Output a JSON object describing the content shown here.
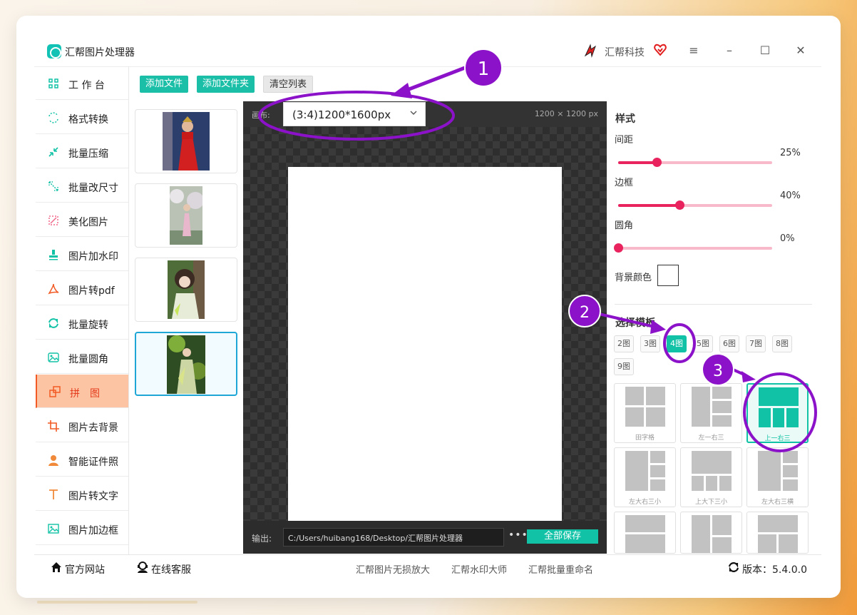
{
  "app": {
    "title": "汇帮图片处理器",
    "brand": "汇帮科技",
    "window_controls": [
      "≡",
      "–",
      "☐",
      "✕"
    ]
  },
  "sidebar": {
    "items": [
      {
        "label": "工 作 台",
        "icon": "grid-icon",
        "active": false
      },
      {
        "label": "格式转换",
        "icon": "convert-icon",
        "active": false
      },
      {
        "label": "批量压缩",
        "icon": "compress-icon",
        "active": false
      },
      {
        "label": "批量改尺寸",
        "icon": "resize-icon",
        "active": false
      },
      {
        "label": "美化图片",
        "icon": "beautify-icon",
        "active": false
      },
      {
        "label": "图片加水印",
        "icon": "watermark-icon",
        "active": false
      },
      {
        "label": "图片转pdf",
        "icon": "pdf-icon",
        "active": false
      },
      {
        "label": "批量旋转",
        "icon": "rotate-icon",
        "active": false
      },
      {
        "label": "批量圆角",
        "icon": "round-corner-icon",
        "active": false
      },
      {
        "label": "拼　图",
        "icon": "collage-icon",
        "active": true
      },
      {
        "label": "图片去背景",
        "icon": "crop-icon",
        "active": false
      },
      {
        "label": "智能证件照",
        "icon": "person-icon",
        "active": false
      },
      {
        "label": "图片转文字",
        "icon": "text-icon",
        "active": false
      },
      {
        "label": "图片加边框",
        "icon": "frame-icon",
        "active": false
      }
    ]
  },
  "toolbar": {
    "add_file": "添加文件",
    "add_folder": "添加文件夹",
    "clear_list": "清空列表"
  },
  "canvas": {
    "label": "画布:",
    "selected": "(3:4)1200*1600px",
    "size_text": "1200 × 1200 px",
    "output_label": "输出:",
    "output_path": "C:/Users/huibang168/Desktop/汇帮图片处理器",
    "more": "•••",
    "save_all": "全部保存"
  },
  "style_panel": {
    "title": "样式",
    "spacing": {
      "label": "间距",
      "value_text": "25%",
      "value": 0.25
    },
    "border": {
      "label": "边框",
      "value_text": "40%",
      "value": 0.4
    },
    "corner": {
      "label": "圆角",
      "value_text": "0%",
      "value": 0.0
    },
    "bg_color_label": "背景颜色",
    "bg_color": "#ffffff",
    "template_title": "选择模板",
    "counts": [
      "2图",
      "3图",
      "4图",
      "5图",
      "6图",
      "7图",
      "8图",
      "9图"
    ],
    "selected_count": "4图",
    "templates": [
      {
        "name": "田字格",
        "selected": false
      },
      {
        "name": "左一右三",
        "selected": false
      },
      {
        "name": "上一右三",
        "selected": true
      },
      {
        "name": "左大右三小",
        "selected": false
      },
      {
        "name": "上大下三小",
        "selected": false
      },
      {
        "name": "左大右三横",
        "selected": false
      }
    ]
  },
  "annotations": [
    "1",
    "2",
    "3"
  ],
  "footer": {
    "website": "官方网站",
    "service": "在线客服",
    "links": [
      "汇帮图片无损放大",
      "汇帮水印大师",
      "汇帮批量重命名"
    ],
    "version": "版本：5.4.0.0"
  },
  "colors": {
    "accent": "#12c2a6",
    "slider": "#e8235e",
    "active_sidebar": "#fdc4a3",
    "annotation": "#8b12c8"
  }
}
